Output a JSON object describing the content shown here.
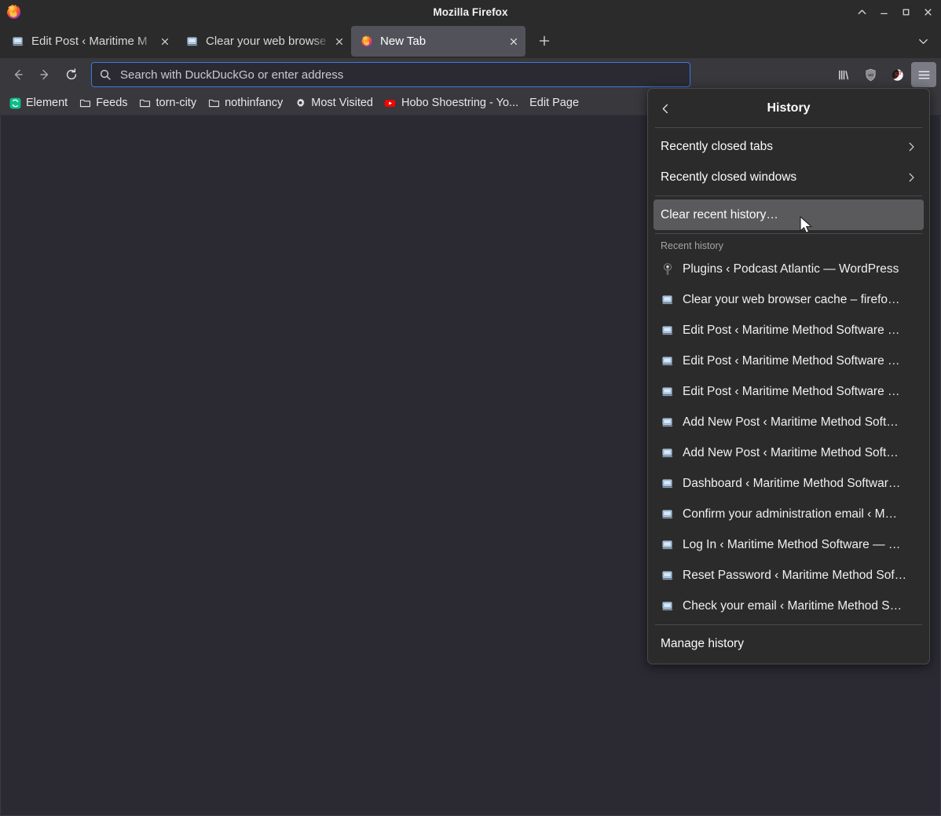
{
  "window": {
    "title": "Mozilla Firefox",
    "controls": [
      {
        "name": "shade-button",
        "glyph": "⌃"
      },
      {
        "name": "minimize-button",
        "glyph": "–"
      },
      {
        "name": "maximize-button",
        "glyph": "□"
      },
      {
        "name": "close-button",
        "glyph": "✕"
      }
    ]
  },
  "tabs": {
    "items": [
      {
        "label": "Edit Post ‹ Maritime M",
        "favicon": "generic-page-icon",
        "active": false
      },
      {
        "label": "Clear your web browse",
        "favicon": "generic-page-icon",
        "active": false
      },
      {
        "label": "New Tab",
        "favicon": "firefox-icon",
        "active": true
      }
    ],
    "new_tab_label": "+",
    "list_all_tabs_icon": "chevron-down-icon"
  },
  "toolbar": {
    "back_icon": "back-arrow-icon",
    "forward_icon": "forward-arrow-icon",
    "reload_icon": "reload-icon",
    "urlbar": {
      "placeholder": "Search with DuckDuckGo or enter address",
      "value": "",
      "search_icon": "search-icon"
    },
    "right_buttons": [
      {
        "name": "library-button",
        "icon": "library-icon"
      },
      {
        "name": "ublock-origin-button",
        "icon": "shield-icon",
        "label": "uO"
      },
      {
        "name": "extension-button",
        "icon": "sponsorblock-icon"
      },
      {
        "name": "app-menu-button",
        "icon": "hamburger-icon",
        "pressed": true
      }
    ]
  },
  "bookmarks": {
    "items": [
      {
        "label": "Element",
        "icon": "element-icon"
      },
      {
        "label": "Feeds",
        "icon": "folder-icon"
      },
      {
        "label": "torn-city",
        "icon": "folder-icon"
      },
      {
        "label": "nothinfancy",
        "icon": "folder-icon"
      },
      {
        "label": "Most Visited",
        "icon": "gear-icon"
      },
      {
        "label": "Hobo Shoestring - Yo...",
        "icon": "youtube-icon"
      },
      {
        "label": "Edit Page",
        "icon": "none"
      }
    ]
  },
  "history_panel": {
    "title": "History",
    "back_icon": "chevron-left-icon",
    "top_items": [
      {
        "label": "Recently closed tabs",
        "chevron": "›",
        "highlight": false
      },
      {
        "label": "Recently closed windows",
        "chevron": "›",
        "highlight": false
      }
    ],
    "clear_item": {
      "label": "Clear recent history…",
      "highlight": true
    },
    "section_label": "Recent history",
    "entries": [
      {
        "label": "Plugins ‹ Podcast Atlantic — WordPress",
        "favicon": "podcast-mic-icon"
      },
      {
        "label": "Clear your web browser cache – firefo…",
        "favicon": "generic-page-icon"
      },
      {
        "label": "Edit Post ‹ Maritime Method Software …",
        "favicon": "generic-page-icon"
      },
      {
        "label": "Edit Post ‹ Maritime Method Software …",
        "favicon": "generic-page-icon"
      },
      {
        "label": "Edit Post ‹ Maritime Method Software …",
        "favicon": "generic-page-icon"
      },
      {
        "label": "Add New Post ‹ Maritime Method Soft…",
        "favicon": "generic-page-icon"
      },
      {
        "label": "Add New Post ‹ Maritime Method Soft…",
        "favicon": "generic-page-icon"
      },
      {
        "label": "Dashboard ‹ Maritime Method Softwar…",
        "favicon": "generic-page-icon"
      },
      {
        "label": "Confirm your administration email ‹ M…",
        "favicon": "generic-page-icon"
      },
      {
        "label": "Log In ‹ Maritime Method Software — …",
        "favicon": "generic-page-icon"
      },
      {
        "label": "Reset Password ‹ Maritime Method Sof…",
        "favicon": "generic-page-icon"
      },
      {
        "label": "Check your email ‹ Maritime Method S…",
        "favicon": "generic-page-icon"
      }
    ],
    "manage_label": "Manage history"
  },
  "colors": {
    "titlebar": "#2b2b2b",
    "toolbar": "#38383d",
    "content": "#2b2a33",
    "panel": "#2b2b2b",
    "urlbar_focus_border": "#3b7ad9",
    "active_tab": "#52525a",
    "highlight": "#5a5a5d"
  }
}
